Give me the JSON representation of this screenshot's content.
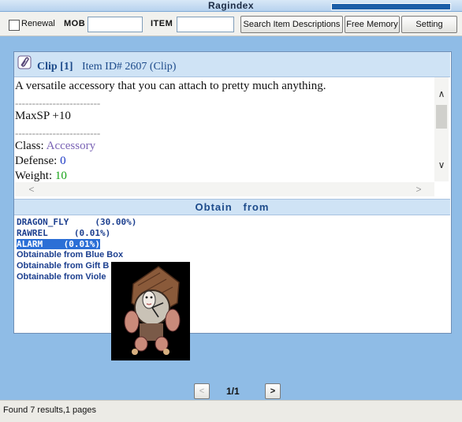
{
  "window": {
    "title": "Ragindex"
  },
  "toolbar": {
    "renewal_label": "Renewal",
    "mob_label": "MOB",
    "mob_value": "",
    "item_label": "ITEM",
    "item_value": "",
    "search_button": "Search Item Descriptions",
    "free_memory_button": "Free Memory",
    "setting_button": "Setting"
  },
  "item": {
    "title": "Clip [1]",
    "id_text": "Item ID# 2607 (Clip)",
    "description": "A versatile accessory that you can attach to pretty much anything.",
    "separator": "-------------------------",
    "bonus": "MaxSP +10",
    "class_label": "Class:",
    "class_value": "Accessory",
    "defense_label": "Defense:",
    "defense_value": "0",
    "weight_label": "Weight:",
    "weight_value": "10"
  },
  "obtain": {
    "header": "Obtain   from",
    "drops": [
      {
        "name": "DRAGON_FLY",
        "rate": "(30.00%)"
      },
      {
        "name": "RAWREL",
        "rate": "(0.01%)"
      },
      {
        "name": "ALARM",
        "rate": "(0.01%)"
      }
    ],
    "boxes": [
      "Obtainable from Blue Box",
      "Obtainable from Gift B",
      "Obtainable from Viole"
    ]
  },
  "pager": {
    "text": "1/1",
    "prev": "<",
    "next": ">"
  },
  "status": {
    "text": "Found 7 results,1 pages"
  },
  "colors": {
    "accent": "#1c4a8a",
    "background": "#8fbce6",
    "selection": "#2b6fd6"
  }
}
